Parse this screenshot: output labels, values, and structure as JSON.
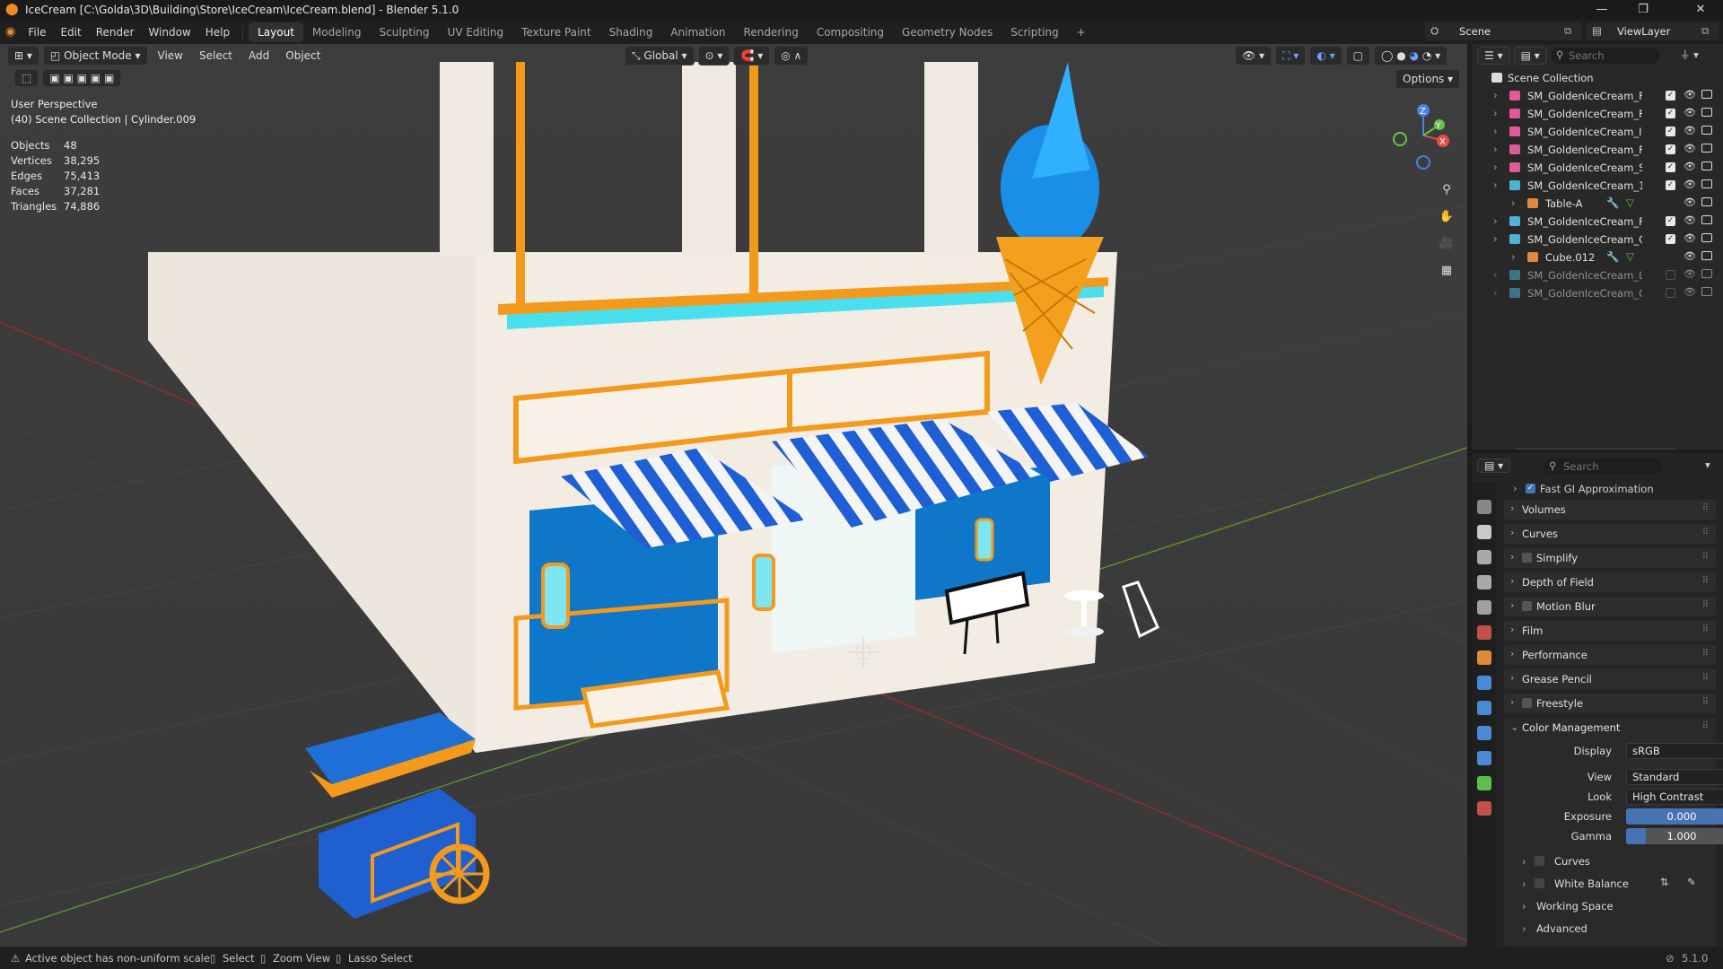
{
  "window": {
    "title": "IceCream [C:\\Golda\\3D\\Building\\Store\\IceCream\\IceCream.blend] - Blender 5.1.0",
    "minimize": "—",
    "maximize": "❐",
    "close": "✕"
  },
  "menus": [
    "File",
    "Edit",
    "Render",
    "Window",
    "Help"
  ],
  "workspaces": [
    "Layout",
    "Modeling",
    "Sculpting",
    "UV Editing",
    "Texture Paint",
    "Shading",
    "Animation",
    "Rendering",
    "Compositing",
    "Geometry Nodes",
    "Scripting",
    "+"
  ],
  "active_workspace": "Layout",
  "scene": {
    "label": "Scene",
    "view_layer": "ViewLayer"
  },
  "viewport": {
    "mode": "Object Mode",
    "menus": [
      "View",
      "Select",
      "Add",
      "Object"
    ],
    "orientation": "Global",
    "options": "Options",
    "perspective": "User Perspective",
    "context": "(40) Scene Collection | Cylinder.009",
    "stats": [
      {
        "label": "Objects",
        "value": "48"
      },
      {
        "label": "Vertices",
        "value": "38,295"
      },
      {
        "label": "Edges",
        "value": "75,413"
      },
      {
        "label": "Faces",
        "value": "37,281"
      },
      {
        "label": "Triangles",
        "value": "74,886"
      }
    ],
    "gizmo": {
      "z": "Z",
      "x": "X",
      "y": "Y"
    }
  },
  "outliner": {
    "search_placeholder": "Search",
    "root": "Scene Collection",
    "rows": [
      {
        "name": "SM_GoldenIceCream_F",
        "kind": "collection",
        "color": "#e05a9a",
        "checked": true,
        "indent": 0
      },
      {
        "name": "SM_GoldenIceCream_F",
        "kind": "collection",
        "color": "#e05a9a",
        "checked": true,
        "indent": 0
      },
      {
        "name": "SM_GoldenIceCream_I",
        "kind": "collection",
        "color": "#e05a9a",
        "checked": true,
        "indent": 0
      },
      {
        "name": "SM_GoldenIceCream_F",
        "kind": "collection",
        "color": "#e05a9a",
        "checked": true,
        "indent": 0
      },
      {
        "name": "SM_GoldenIceCream_S",
        "kind": "collection",
        "color": "#e05a9a",
        "checked": true,
        "indent": 0
      },
      {
        "name": "SM_GoldenIceCream_1",
        "kind": "collection",
        "color": "#4fb3d9",
        "checked": true,
        "indent": 0
      },
      {
        "name": "Table-A",
        "kind": "object",
        "color": "#e08a3c",
        "checked": false,
        "indent": 1
      },
      {
        "name": "SM_GoldenIceCream_F",
        "kind": "collection",
        "color": "#4fb3d9",
        "checked": true,
        "indent": 0
      },
      {
        "name": "SM_GoldenIceCream_C",
        "kind": "collection",
        "color": "#4fb3d9",
        "checked": true,
        "indent": 0
      },
      {
        "name": "Cube.012",
        "kind": "object",
        "color": "#e08a3c",
        "checked": false,
        "indent": 1
      },
      {
        "name": "SM_GoldenIceCream_L",
        "kind": "collection",
        "color": "#4fb3d9",
        "checked": false,
        "indent": 0
      },
      {
        "name": "SM_GoldenIceCream_C",
        "kind": "collection",
        "color": "#4fb3d9",
        "checked": false,
        "indent": 0
      }
    ]
  },
  "properties": {
    "search_placeholder": "Search",
    "top_item": "Fast GI Approximation",
    "panels": [
      "Volumes",
      "Curves",
      "Simplify",
      "Depth of Field",
      "Motion Blur",
      "Film",
      "Performance",
      "Grease Pencil",
      "Freestyle"
    ],
    "color_management": {
      "title": "Color Management",
      "display_label": "Display",
      "display": "sRGB",
      "view_label": "View",
      "view": "Standard",
      "look_label": "Look",
      "look": "High Contrast",
      "exposure_label": "Exposure",
      "exposure": "0.000",
      "gamma_label": "Gamma",
      "gamma": "1.000",
      "subpanels": [
        "Curves",
        "White Balance",
        "Working Space",
        "Advanced"
      ]
    }
  },
  "statusbar": {
    "warning": "Active object has non-uniform scale",
    "hints": [
      "Select",
      "Zoom View",
      "Lasso Select"
    ],
    "version": "5.1.0"
  }
}
